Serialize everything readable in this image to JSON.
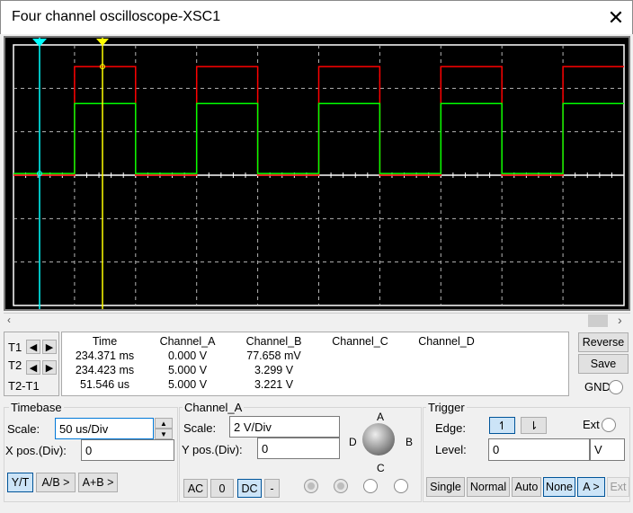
{
  "window": {
    "title": "Four channel oscilloscope-XSC1",
    "close": "✕"
  },
  "colors": {
    "channel_a": "#ff0000",
    "channel_b": "#00ff00",
    "cursor_t1": "#00ffff",
    "cursor_t2": "#ffff00",
    "grid": "#b4b4b4"
  },
  "cursors": {
    "t1_label": "1",
    "t2_label": "2"
  },
  "readout": {
    "headers": [
      "Time",
      "Channel_A",
      "Channel_B",
      "Channel_C",
      "Channel_D"
    ],
    "rows": [
      {
        "label": "T1",
        "time": "234.371 ms",
        "a": "0.000 V",
        "b": "77.658 mV",
        "c": "",
        "d": ""
      },
      {
        "label": "T2",
        "time": "234.423 ms",
        "a": "5.000 V",
        "b": "3.299 V",
        "c": "",
        "d": ""
      },
      {
        "label": "T2-T1",
        "time": "51.546 us",
        "a": "5.000 V",
        "b": "3.221 V",
        "c": "",
        "d": ""
      }
    ]
  },
  "side": {
    "reverse": "Reverse",
    "save": "Save",
    "gnd": "GND"
  },
  "timebase": {
    "title": "Timebase",
    "scale_label": "Scale:",
    "scale": "50 us/Div",
    "xpos_label": "X pos.(Div):",
    "xpos": "0",
    "yt": "Y/T",
    "ab": "A/B >",
    "apb": "A+B >"
  },
  "channel": {
    "title": "Channel_A",
    "scale_label": "Scale:",
    "scale": "2  V/Div",
    "ypos_label": "Y pos.(Div):",
    "ypos": "0",
    "ac": "AC",
    "zero": "0",
    "dc": "DC",
    "minus": "-",
    "knob": {
      "a": "A",
      "b": "B",
      "c": "C",
      "d": "D"
    }
  },
  "trigger": {
    "title": "Trigger",
    "edge_label": "Edge:",
    "level_label": "Level:",
    "level": "0",
    "unit": "V",
    "ext": "Ext",
    "single": "Single",
    "normal": "Normal",
    "auto": "Auto",
    "none": "None",
    "a": "A >",
    "ext_btn": "Ext",
    "rise_icon": "↿",
    "fall_icon": "⇂"
  }
}
